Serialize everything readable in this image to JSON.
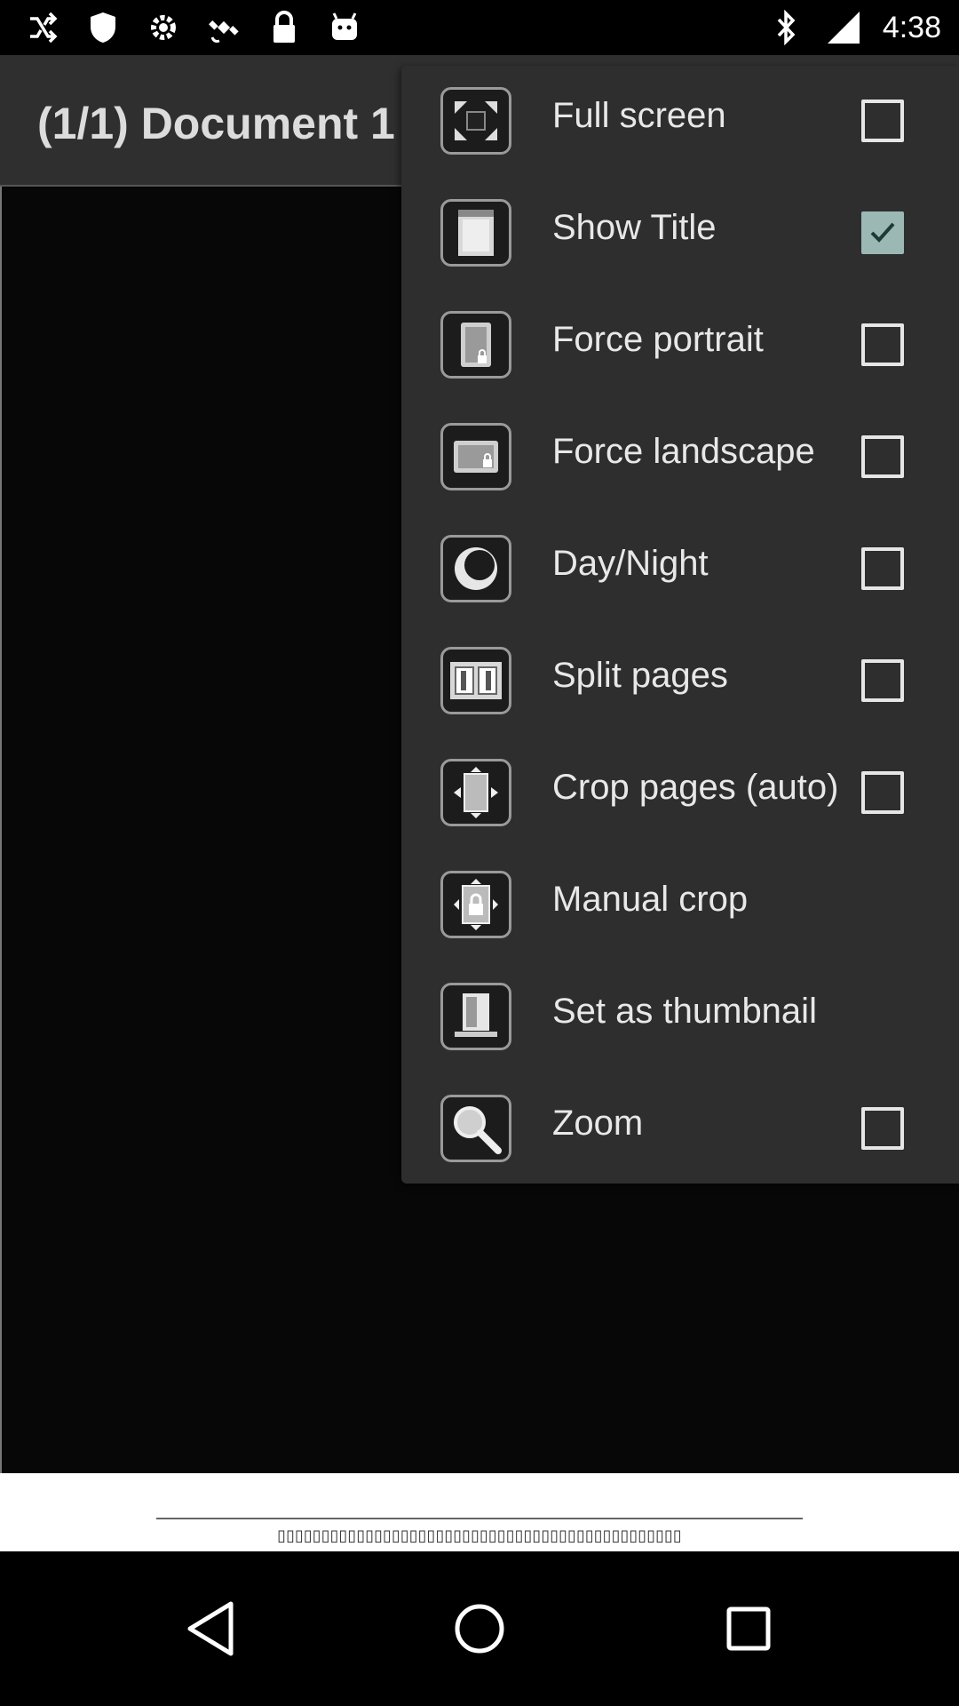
{
  "status_bar": {
    "time": "4:38",
    "left_icons": [
      "shuffle-icon",
      "shield-icon",
      "gear-icon",
      "satellite-icon",
      "lock-icon",
      "android-icon"
    ],
    "right_icons": [
      "bluetooth-icon",
      "signal-icon"
    ]
  },
  "title_bar": {
    "title": "(1/1) Document 1"
  },
  "menu": {
    "items": [
      {
        "label": "Full screen",
        "icon": "fullscreen-icon",
        "checkbox": true,
        "checked": false
      },
      {
        "label": "Show Title",
        "icon": "show-title-icon",
        "checkbox": true,
        "checked": true
      },
      {
        "label": "Force portrait",
        "icon": "force-portrait-icon",
        "checkbox": true,
        "checked": false
      },
      {
        "label": "Force landscape",
        "icon": "force-landscape-icon",
        "checkbox": true,
        "checked": false
      },
      {
        "label": "Day/Night",
        "icon": "moon-icon",
        "checkbox": true,
        "checked": false
      },
      {
        "label": "Split pages",
        "icon": "split-pages-icon",
        "checkbox": true,
        "checked": false
      },
      {
        "label": "Crop pages (auto)",
        "icon": "crop-auto-icon",
        "checkbox": true,
        "checked": false
      },
      {
        "label": "Manual crop",
        "icon": "manual-crop-icon",
        "checkbox": false,
        "checked": false
      },
      {
        "label": "Set as thumbnail",
        "icon": "thumbnail-icon",
        "checkbox": false,
        "checked": false
      },
      {
        "label": "Zoom",
        "icon": "zoom-icon",
        "checkbox": true,
        "checked": false
      }
    ]
  },
  "footer": {
    "caption": "▯▯▯▯▯▯▯▯▯▯▯▯▯▯▯▯▯▯▯▯▯▯▯▯▯▯▯▯▯▯▯▯▯▯▯▯▯▯▯▯▯▯▯▯▯▯"
  },
  "nav_bar": {
    "buttons": [
      "back-icon",
      "home-icon",
      "recents-icon"
    ]
  }
}
